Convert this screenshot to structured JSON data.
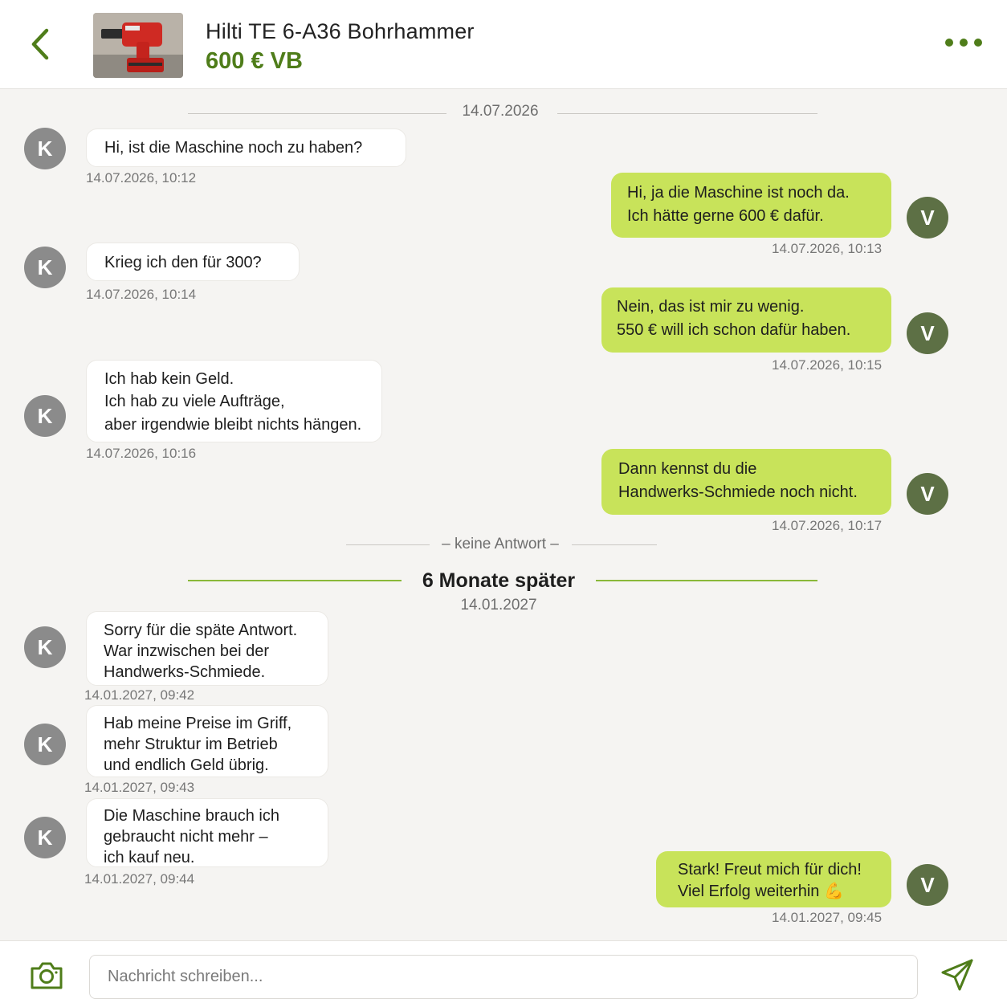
{
  "header": {
    "title": "Hilti TE 6-A36 Bohrhammer",
    "price": "600 € VB",
    "thumbnail_icon": "drill-image",
    "back_icon": "chevron-left-icon",
    "more_icon": "more-horizontal-icon"
  },
  "date_separator": "14.07.2026",
  "messages": [
    {
      "from": "K",
      "lines": [
        "Hi, ist die Maschine noch zu haben?"
      ],
      "time": "14.07.2026, 10:12"
    },
    {
      "from": "V",
      "lines": [
        "Hi, ja die Maschine ist noch da.",
        "Ich hätte gerne 600 € dafür."
      ],
      "time": "14.07.2026, 10:13"
    },
    {
      "from": "K",
      "lines": [
        "Krieg ich den für 300?"
      ],
      "time": "14.07.2026, 10:14"
    },
    {
      "from": "V",
      "lines": [
        "Nein, das ist mir zu wenig.",
        "550 € will ich schon dafür haben."
      ],
      "time": "14.07.2026, 10:15"
    },
    {
      "from": "K",
      "lines": [
        "Ich hab kein Geld.",
        "Ich hab zu viele Aufträge,",
        "aber irgendwie bleibt nichts hängen."
      ],
      "time": "14.07.2026, 10:16"
    },
    {
      "from": "V",
      "lines": [
        "Dann kennst du die",
        "Handwerks-Schmiede noch nicht."
      ],
      "time": "14.07.2026, 10:17"
    },
    {
      "from": "K",
      "lines": [
        "Sorry für die späte Antwort.",
        "War inzwischen bei der",
        "Handwerks-Schmiede."
      ],
      "time": "14.01.2027, 09:42"
    },
    {
      "from": "K",
      "lines": [
        "Hab meine Preise im Griff,",
        "mehr Struktur im Betrieb",
        "und endlich Geld übrig."
      ],
      "time": "14.01.2027, 09:43"
    },
    {
      "from": "K",
      "lines": [
        "Die Maschine brauch ich",
        "gebraucht nicht mehr –",
        "ich kauf neu."
      ],
      "time": "14.01.2027, 09:44"
    },
    {
      "from": "V",
      "lines": [
        "Stark! Freut mich für dich!",
        "Viel Erfolg weiterhin 💪"
      ],
      "time": "14.01.2027, 09:45"
    }
  ],
  "no_reply": "– keine Antwort –",
  "time_skip": {
    "label": "6 Monate später",
    "date": "14.01.2027"
  },
  "footer": {
    "placeholder": "Nachricht schreiben...",
    "camera_icon": "camera-icon",
    "send_icon": "send-icon"
  },
  "colors": {
    "accent": "#4f7d1a",
    "outgoing_bubble": "#c8e35a",
    "incoming_bubble": "#ffffff",
    "avatar_k": "#8b8b8b",
    "avatar_v": "#5d7045"
  }
}
